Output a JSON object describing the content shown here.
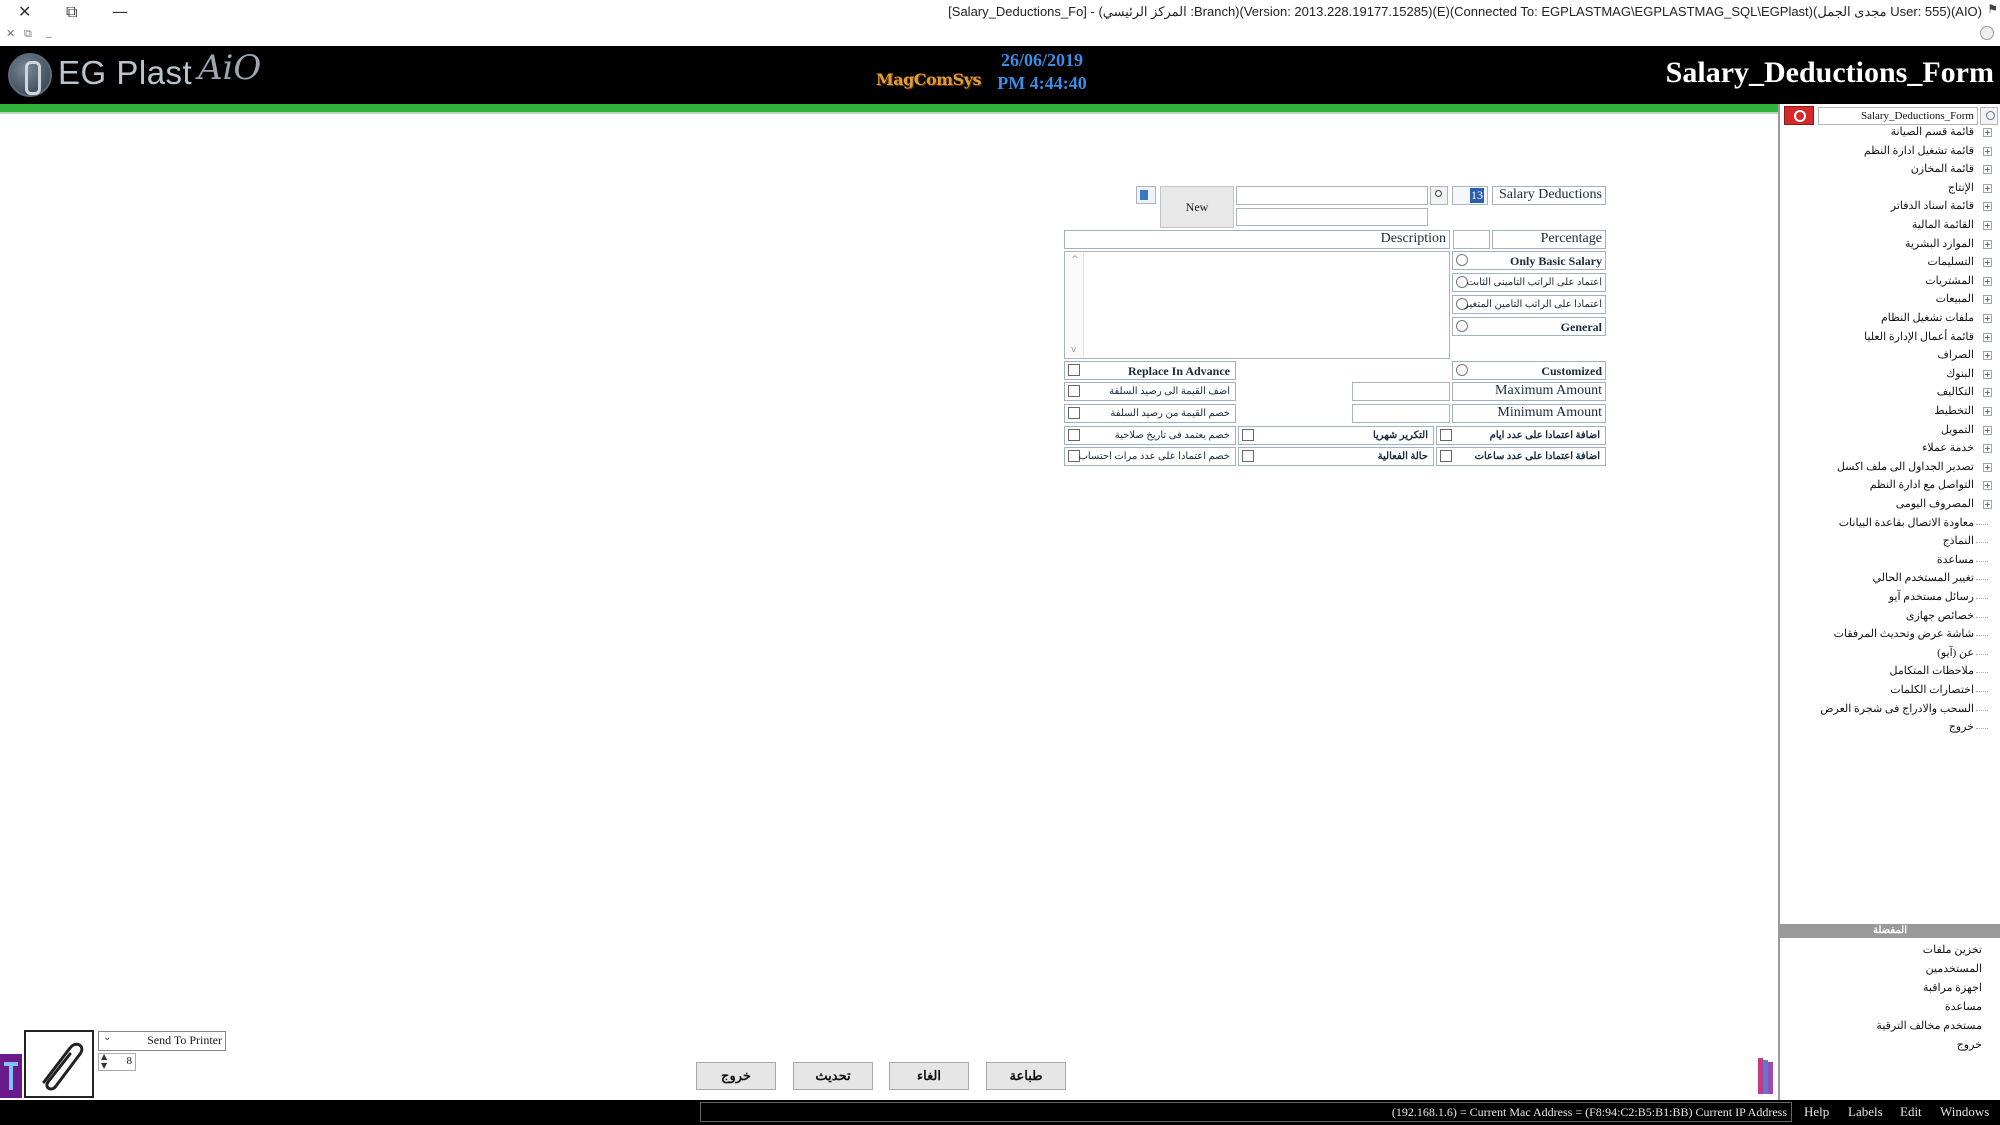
{
  "window": {
    "title": "[Salary_Deductions_Fo] - (المركز الرئيسي :Branch)(Version: 2013.228.19177.15285)(E)(Connected To: EGPLASTMAG\\EGPLASTMAG_SQL\\EGPlast)(مجدى الجمل User: 555)(AIO)",
    "controls": {
      "close": "✕",
      "restore": "⧉",
      "minimize": "—"
    },
    "small_controls": {
      "close": "✕",
      "restore": "⧉",
      "minimize": "_"
    }
  },
  "header": {
    "brand": "EG Plast",
    "brand_sub": "AiO",
    "center_logo": "MagComSys",
    "date": "26/06/2019",
    "time": "PM 4:44:40",
    "form_title": "Salary_Deductions_Form",
    "accent_color": "#2fb33a"
  },
  "tree": {
    "search_value": "Salary_Deductions_Form",
    "items": [
      {
        "label": "قائمة قسم الصيانة",
        "expandable": true
      },
      {
        "label": "قائمة تشغيل ادارة النظم",
        "expandable": true
      },
      {
        "label": "قائمة المخازن",
        "expandable": true
      },
      {
        "label": "الإنتاج",
        "expandable": true
      },
      {
        "label": "قائمة اسناد الدفاتر",
        "expandable": true
      },
      {
        "label": "القائمة المالية",
        "expandable": true
      },
      {
        "label": "الموارد البشرية",
        "expandable": true
      },
      {
        "label": "التسليمات",
        "expandable": true
      },
      {
        "label": "المشتريات",
        "expandable": true
      },
      {
        "label": "المبيعات",
        "expandable": true
      },
      {
        "label": "ملفات تشغيل النظام",
        "expandable": true
      },
      {
        "label": "قائمة أعمال الإدارة العليا",
        "expandable": true
      },
      {
        "label": "الصراف",
        "expandable": true
      },
      {
        "label": "البنوك",
        "expandable": true
      },
      {
        "label": "التكاليف",
        "expandable": true
      },
      {
        "label": "التخطيط",
        "expandable": true
      },
      {
        "label": "التمويل",
        "expandable": true
      },
      {
        "label": "خدمة عملاء",
        "expandable": true
      },
      {
        "label": "تصدير الجداول الى ملف اكسل",
        "expandable": true
      },
      {
        "label": "التواصل مع ادارة النظم",
        "expandable": true
      },
      {
        "label": "المصروف اليومى",
        "expandable": true
      },
      {
        "label": "معاودة الاتصال بقاعدة البيانات",
        "expandable": false
      },
      {
        "label": "النماذج",
        "expandable": false
      },
      {
        "label": "مساعدة",
        "expandable": false
      },
      {
        "label": "تغيير المستخدم الحالي",
        "expandable": false
      },
      {
        "label": "رسائل مستخدم آيو",
        "expandable": false
      },
      {
        "label": "خصائص جهازى",
        "expandable": false
      },
      {
        "label": "شاشة عرض وتحديث المرفقات",
        "expandable": false
      },
      {
        "label": "عن (آيو)",
        "expandable": false
      },
      {
        "label": "ملاحظات المتكامل",
        "expandable": false
      },
      {
        "label": "اختصارات الكلمات",
        "expandable": false
      },
      {
        "label": "السحب والادراج فى شجرة العرض",
        "expandable": false
      },
      {
        "label": "خروج",
        "expandable": false
      }
    ]
  },
  "favorites": {
    "header": "المفضلة",
    "items": [
      "تخزين ملفات",
      "المستخدمين",
      "اجهزة مراقبة",
      "مساعدة",
      "مستخدم مخالف الترقية",
      "خروج"
    ]
  },
  "form": {
    "new_button": "New",
    "code_value": "13",
    "code_title": "Salary Deductions",
    "search_value": "",
    "description_label": "Description",
    "description_value": "",
    "percentage_label": "Percentage",
    "percentage_value": "",
    "radios": [
      {
        "label": "Only Basic Salary",
        "checked": false
      },
      {
        "label": "اعتماد على الراتب التامينى الثابت",
        "checked": false
      },
      {
        "label": "اعتمادا على الراتب التامين المتغير",
        "checked": false
      },
      {
        "label": "General",
        "checked": false
      }
    ],
    "customized_label": "Customized",
    "max_label": "Maximum Amount",
    "max_value": "",
    "min_label": "Minimum Amount",
    "min_value": "",
    "checks_left": [
      {
        "label": "Replace In Advance",
        "checked": false
      },
      {
        "label": "اضف القيمة الى رصيد السلفة",
        "checked": false
      },
      {
        "label": "خصم القيمة من رصيد السلفة",
        "checked": false
      },
      {
        "label": "خصم يعتمد فى تاريخ صلاحية",
        "checked": false
      },
      {
        "label": "خصم اعتمادا على عدد مرات احتساب",
        "checked": false
      }
    ],
    "checks_middle": [
      {
        "label": "التكرير شهريا",
        "checked": false
      },
      {
        "label": "حالة الفعالية",
        "checked": false
      }
    ],
    "checks_right": [
      {
        "label": "اضافة اعتمادا على عدد ايام",
        "checked": false
      },
      {
        "label": "اضافة اعتمادا على عدد ساعات",
        "checked": false
      }
    ]
  },
  "bottom": {
    "printer_option": "Send To Printer",
    "copies": "8",
    "buttons": {
      "exit": "خروج",
      "update": "تحديث",
      "cancel": "الغاء",
      "print": "طباعة"
    }
  },
  "statusbar": {
    "text": "(192.168.1.6) = Current Mac Address = (F8:94:C2:B5:B1:BB) Current IP Address",
    "menu": [
      "Help",
      "Labels",
      "Edit",
      "Windows"
    ]
  }
}
